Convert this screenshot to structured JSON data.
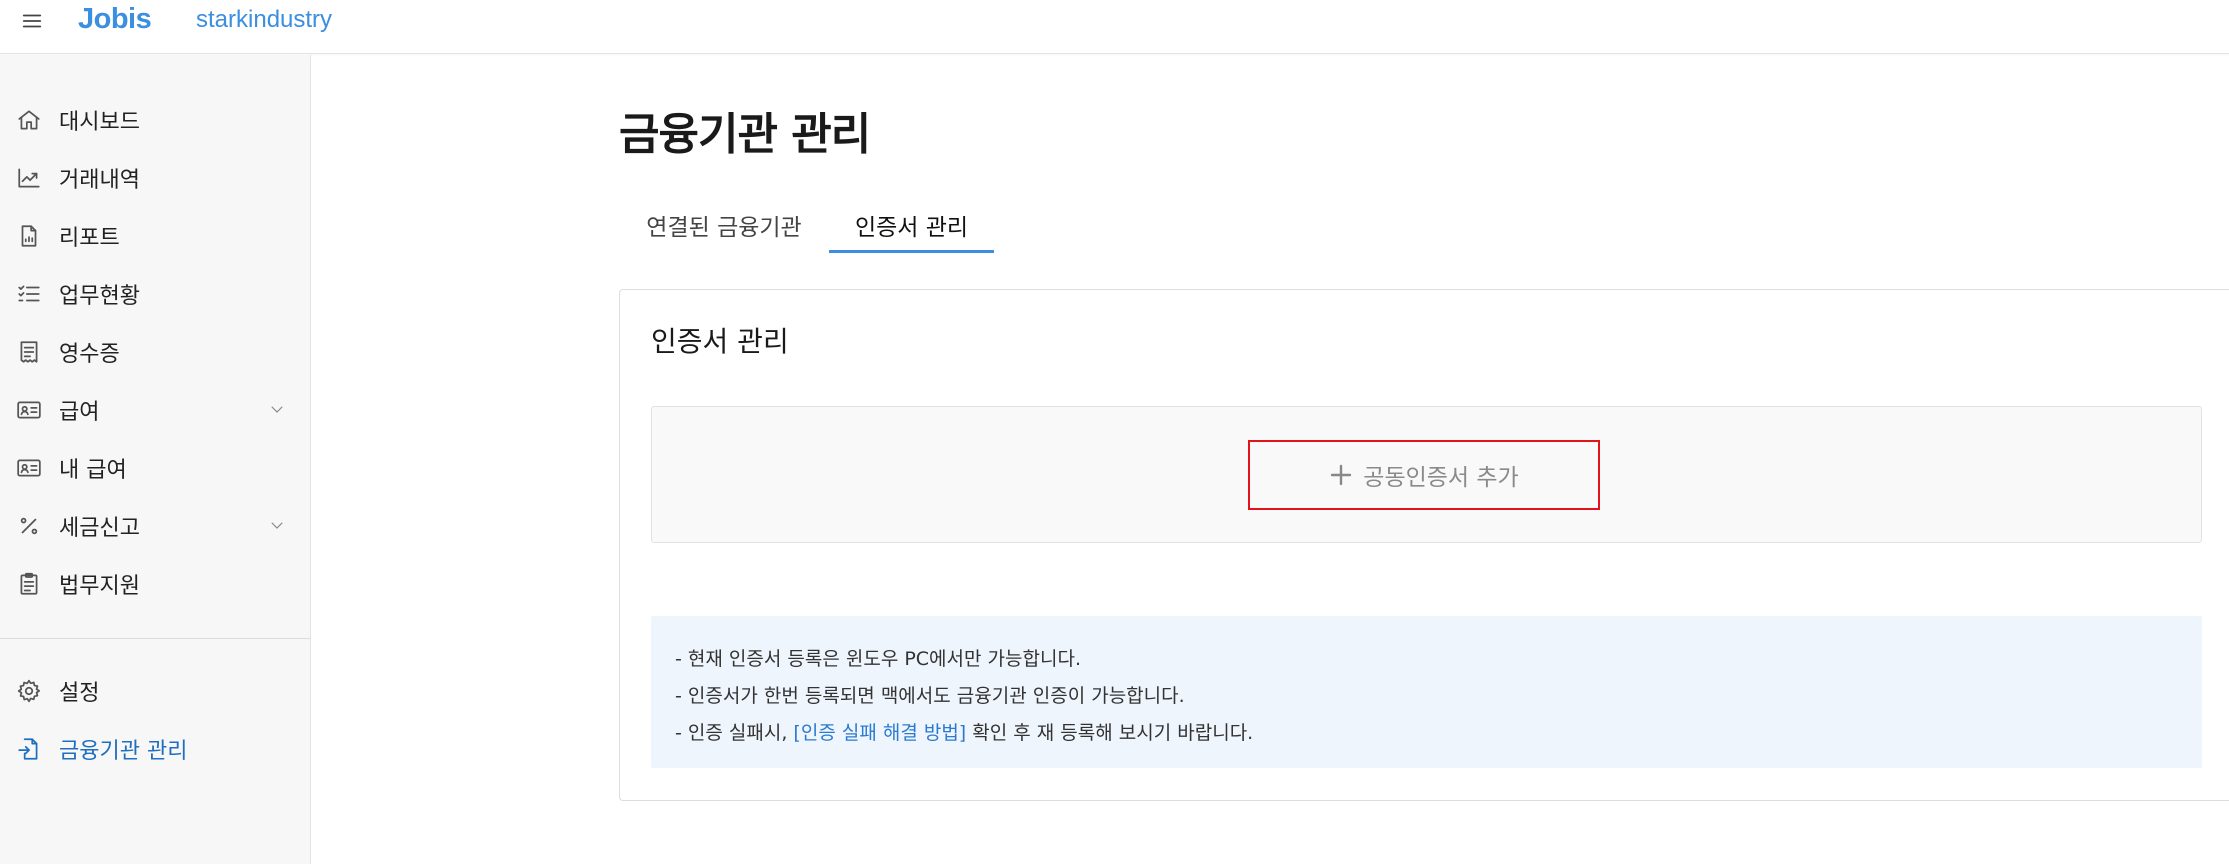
{
  "header": {
    "logo": "Jobis",
    "company": "starkindustry"
  },
  "sidebar": {
    "items": [
      {
        "label": "대시보드",
        "icon": "home-icon"
      },
      {
        "label": "거래내역",
        "icon": "trend-chart-icon"
      },
      {
        "label": "리포트",
        "icon": "report-document-icon"
      },
      {
        "label": "업무현황",
        "icon": "checklist-icon"
      },
      {
        "label": "영수증",
        "icon": "receipt-icon"
      },
      {
        "label": "급여",
        "icon": "id-card-icon",
        "expandable": true
      },
      {
        "label": "내 급여",
        "icon": "id-card-icon"
      },
      {
        "label": "세금신고",
        "icon": "percent-icon",
        "expandable": true
      },
      {
        "label": "법무지원",
        "icon": "clipboard-icon"
      }
    ],
    "bottom_items": [
      {
        "label": "설정",
        "icon": "gear-icon"
      },
      {
        "label": "금융기관 관리",
        "icon": "file-import-icon",
        "active": true
      }
    ]
  },
  "main": {
    "title": "금융기관 관리",
    "tabs": [
      {
        "label": "연결된 금융기관",
        "active": false
      },
      {
        "label": "인증서 관리",
        "active": true
      }
    ],
    "card": {
      "title": "인증서 관리",
      "add_button_label": "공동인증서 추가",
      "notice": {
        "line1": "- 현재 인증서 등록은 윈도우 PC에서만 가능합니다.",
        "line2": "- 인증서가 한번 등록되면 맥에서도 금융기관 인증이 가능합니다.",
        "line3_prefix": "- 인증 실패시, ",
        "line3_link": "[인증 실패 해결 방법]",
        "line3_suffix": " 확인 후 재 등록해 보시기 바랍니다."
      }
    }
  },
  "colors": {
    "accent": "#3b8ee0",
    "active_nav": "#1f6fc0",
    "highlight_border": "#e0141a",
    "notice_bg": "#eff5fc"
  }
}
